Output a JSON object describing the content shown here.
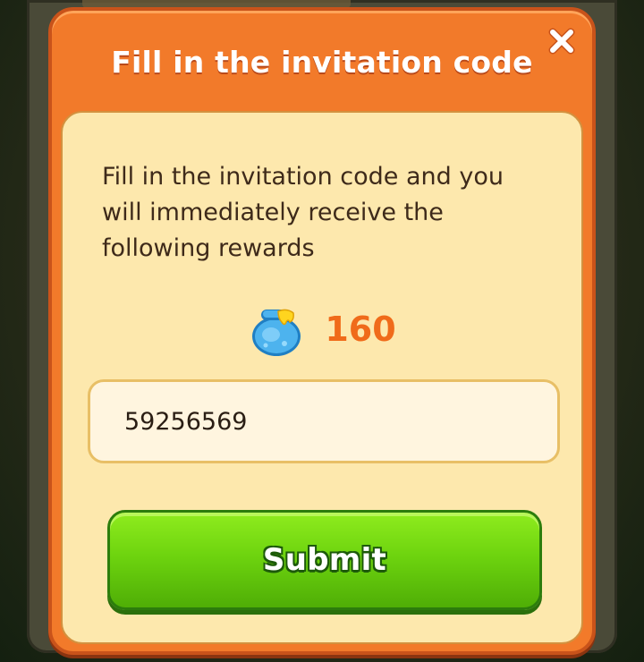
{
  "dialog": {
    "title": "Fill in the invitation code",
    "close_icon": "close-icon",
    "description": "Fill in the invitation code and you will immediately receive the following rewards",
    "reward": {
      "icon": "honey-pot-icon",
      "amount": "160"
    },
    "code_input": {
      "value": "59256569"
    },
    "submit_label": "Submit"
  },
  "colors": {
    "header_orange": "#f27a2a",
    "panel_cream": "#fde8ad",
    "reward_orange": "#f06b1a",
    "submit_green": "#6ed40f"
  }
}
